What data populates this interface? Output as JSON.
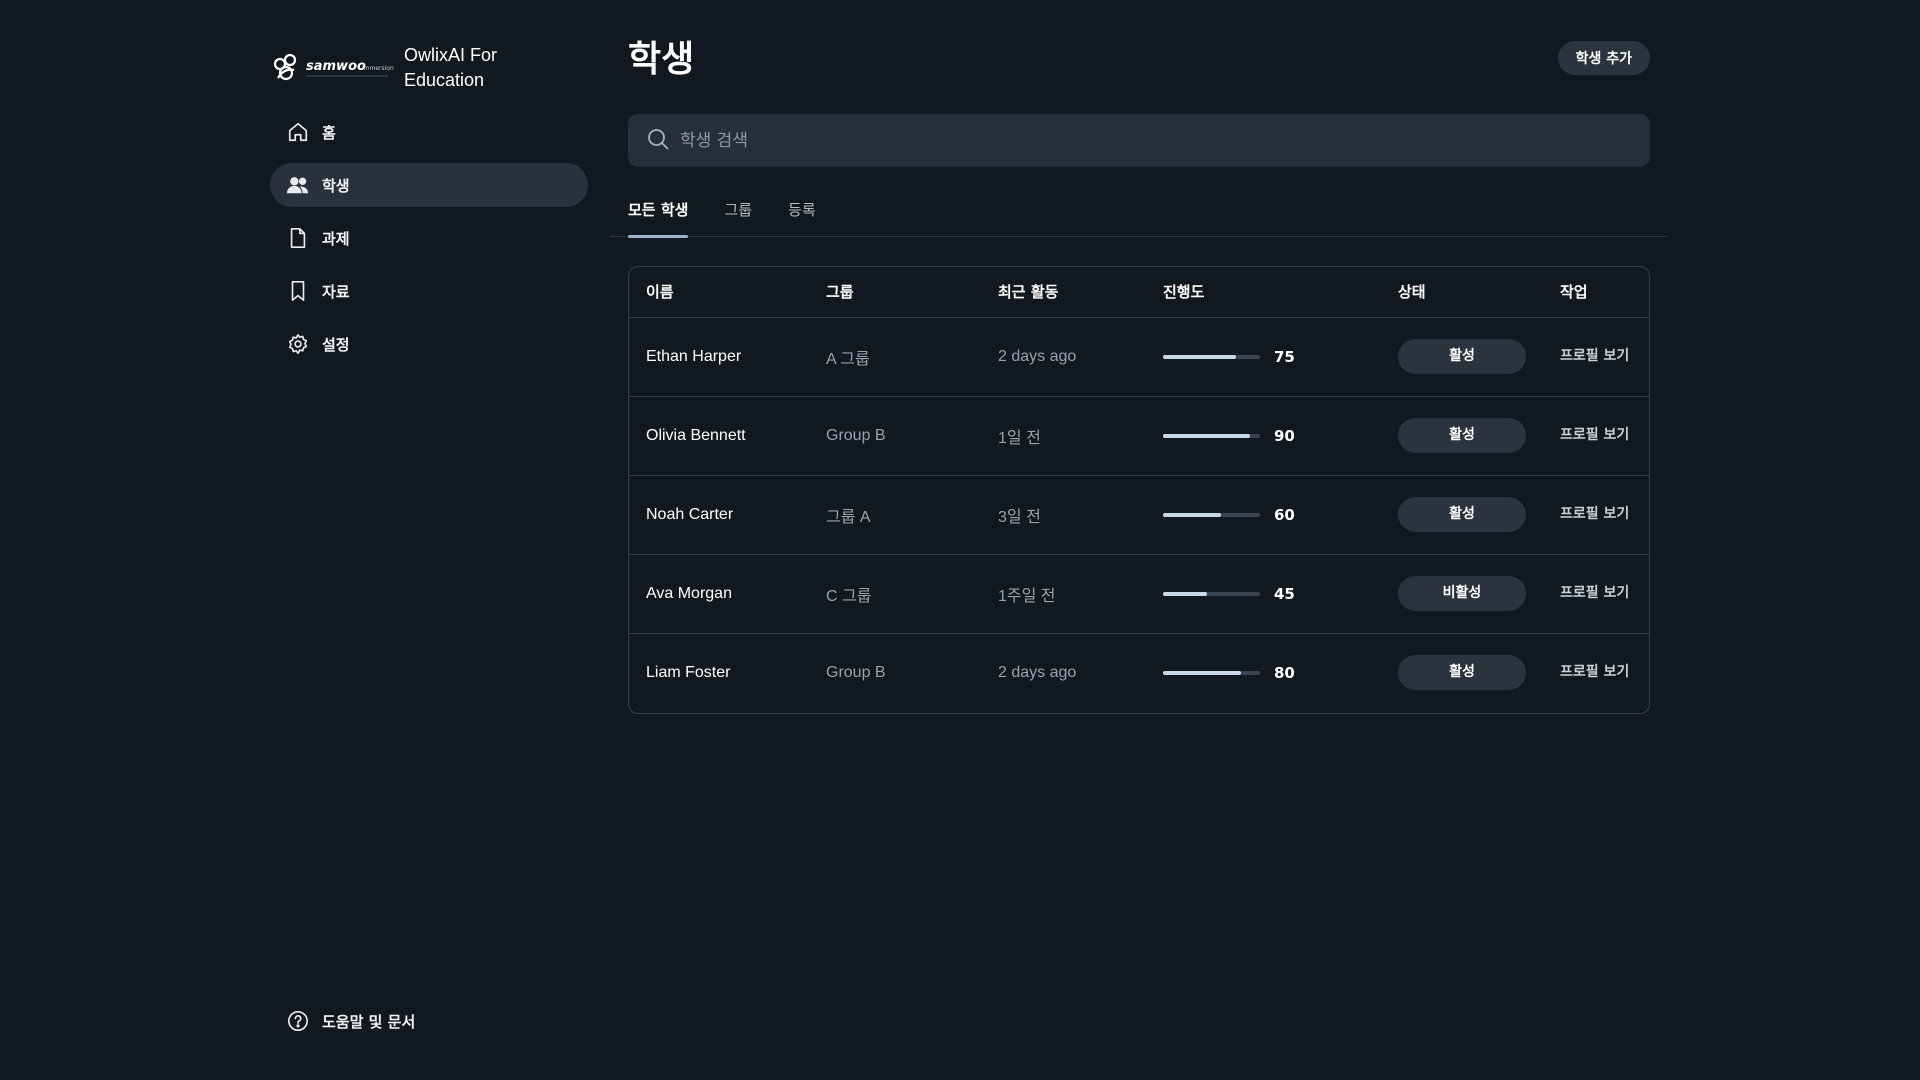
{
  "brand": {
    "name": "OwlixAI For Education",
    "logo_text": "samwoo",
    "logo_sub": "immersion"
  },
  "nav": [
    {
      "label": "홈",
      "icon": "home-icon"
    },
    {
      "label": "학생",
      "icon": "users-icon",
      "active": true
    },
    {
      "label": "과제",
      "icon": "file-icon"
    },
    {
      "label": "자료",
      "icon": "bookmark-icon"
    },
    {
      "label": "설정",
      "icon": "gear-icon"
    }
  ],
  "help": {
    "label": "도움말 및 문서",
    "icon": "help-circle-icon"
  },
  "page": {
    "title": "학생",
    "add_label": "학생 추가"
  },
  "search": {
    "placeholder": "학생 검색"
  },
  "tabs": [
    {
      "label": "모든 학생",
      "active": true
    },
    {
      "label": "그룹"
    },
    {
      "label": "등록"
    }
  ],
  "table": {
    "headers": [
      "이름",
      "그룹",
      "최근 활동",
      "진행도",
      "상태",
      "작업"
    ],
    "rows": [
      {
        "name": "Ethan Harper",
        "group": "A 그룹",
        "activity": "2 days ago",
        "progress": 75,
        "status": "활성",
        "action": "프로필 보기"
      },
      {
        "name": "Olivia Bennett",
        "group": "Group B",
        "activity": "1일 전",
        "progress": 90,
        "status": "활성",
        "action": "프로필 보기"
      },
      {
        "name": "Noah Carter",
        "group": "그룹 A",
        "activity": "3일 전",
        "progress": 60,
        "status": "활성",
        "action": "프로필 보기"
      },
      {
        "name": "Ava Morgan",
        "group": "C 그룹",
        "activity": "1주일 전",
        "progress": 45,
        "status": "비활성",
        "action": "프로필 보기"
      },
      {
        "name": "Liam Foster",
        "group": "Group B",
        "activity": "2 days ago",
        "progress": 80,
        "status": "활성",
        "action": "프로필 보기"
      }
    ]
  },
  "colors": {
    "background": "#121820",
    "surface": "#262e39",
    "pill": "#2b333e",
    "progress_fill": "#c9d7e8"
  }
}
